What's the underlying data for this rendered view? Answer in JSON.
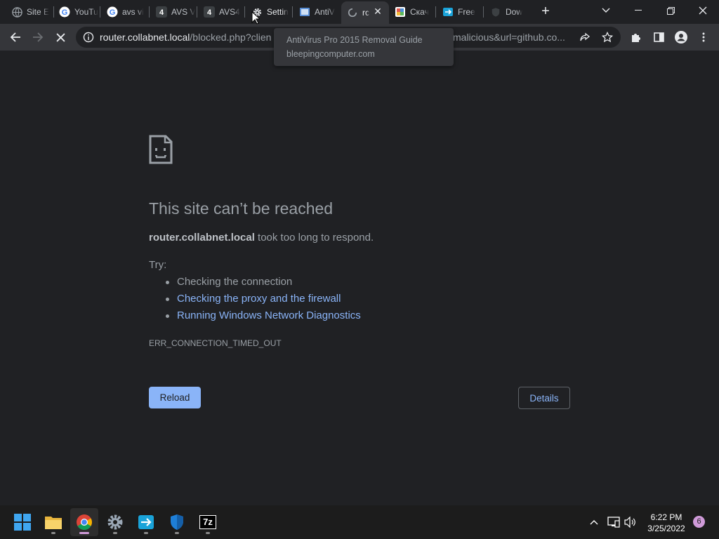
{
  "tabs": [
    {
      "label": "Site E",
      "icon": "globe-icon"
    },
    {
      "label": "YouTu",
      "icon": "google-icon"
    },
    {
      "label": "avs vi",
      "icon": "google-icon"
    },
    {
      "label": "AVS V",
      "icon": "avs4you-icon"
    },
    {
      "label": "AVS4",
      "icon": "avs4you-icon"
    },
    {
      "label": "Settin",
      "icon": "gear-icon"
    },
    {
      "label": "AntiV",
      "icon": "antivirus-icon"
    },
    {
      "label": "rc",
      "icon": "loading-spinner-icon",
      "active": true
    },
    {
      "label": "Скач",
      "icon": "download-site-icon"
    },
    {
      "label": "Free",
      "icon": "free-app-icon"
    },
    {
      "label": "Dow",
      "icon": "shield-icon"
    }
  ],
  "tooltip": {
    "title": "AntiVirus Pro 2015 Removal Guide",
    "domain": "bleepingcomputer.com"
  },
  "address_bar": {
    "host": "router.collabnet.local",
    "path_start": "/blocked.php?clien",
    "path_end": "malicious&url=github.co..."
  },
  "error_page": {
    "title": "This site can’t be reached",
    "host": "router.collabnet.local",
    "message_suffix": " took too long to respond.",
    "try_label": "Try:",
    "suggestions": [
      {
        "text": "Checking the connection",
        "link": false
      },
      {
        "text": "Checking the proxy and the firewall",
        "link": true
      },
      {
        "text": "Running Windows Network Diagnostics",
        "link": true
      }
    ],
    "error_code": "ERR_CONNECTION_TIMED_OUT",
    "reload_label": "Reload",
    "details_label": "Details"
  },
  "taskbar": {
    "apps": [
      "windows-start-icon",
      "file-explorer-icon",
      "chrome-icon",
      "settings-gear-icon",
      "remote-app-icon",
      "windows-security-icon",
      "7zip-icon"
    ],
    "seven_zip_label": "7z",
    "time": "6:22 PM",
    "date": "3/25/2022",
    "notification_count": "6"
  },
  "colors": {
    "link": "#8ab4f8",
    "page_bg": "#202124",
    "toolbar_bg": "#35363a"
  }
}
